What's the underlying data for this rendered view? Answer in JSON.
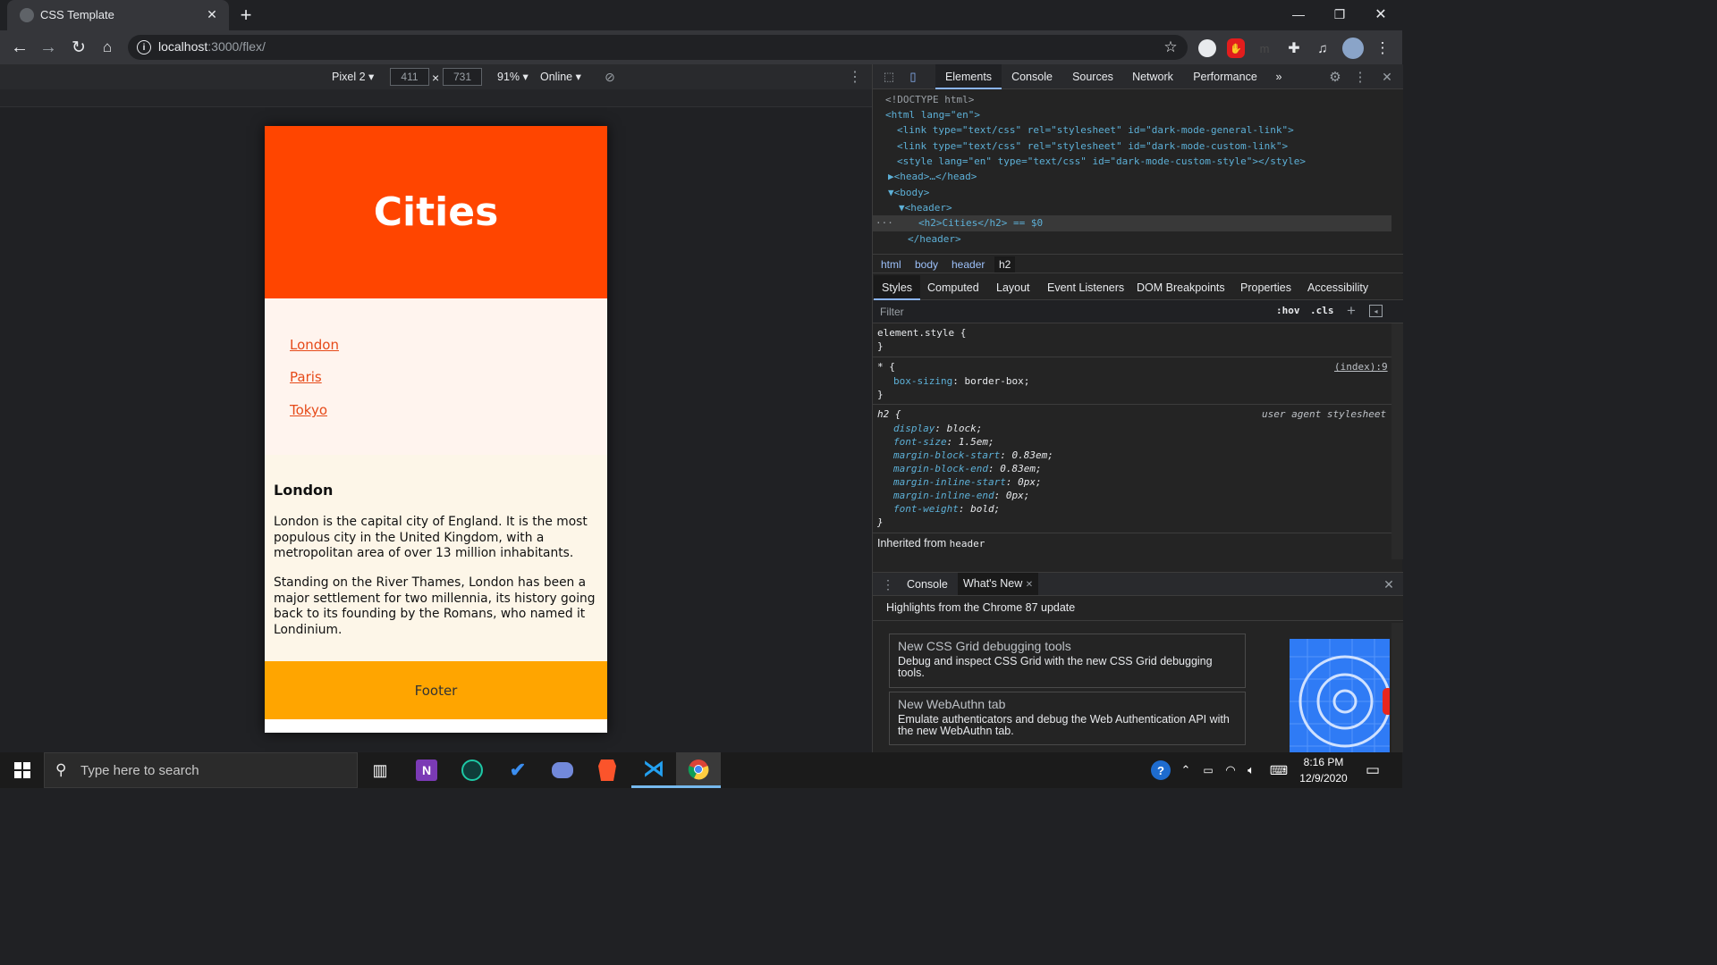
{
  "browser": {
    "tab_title": "CSS Template",
    "url_host": "localhost",
    "url_path": ":3000/flex/"
  },
  "device_toolbar": {
    "device": "Pixel 2",
    "width": "411",
    "times": "×",
    "height": "731",
    "zoom": "91%",
    "network": "Online"
  },
  "emulated_page": {
    "header_title": "Cities",
    "nav_links": [
      "London",
      "Paris",
      "Tokyo"
    ],
    "article_title": "London",
    "article_paragraphs": [
      "London is the capital city of England. It is the most populous city in the United Kingdom, with a metropolitan area of over 13 million inhabitants.",
      "Standing on the River Thames, London has been a major settlement for two millennia, its history going back to its founding by the Romans, who named it Londinium."
    ],
    "footer": "Footer"
  },
  "devtools": {
    "tabs": [
      "Elements",
      "Console",
      "Sources",
      "Network",
      "Performance"
    ],
    "more_tabs": "»",
    "dom_lines": [
      "<!DOCTYPE html>",
      "<html lang=\"en\">",
      "<link type=\"text/css\" rel=\"stylesheet\" id=\"dark-mode-general-link\">",
      "<link type=\"text/css\" rel=\"stylesheet\" id=\"dark-mode-custom-link\">",
      "<style lang=\"en\" type=\"text/css\" id=\"dark-mode-custom-style\"></style>",
      "▶<head>…</head>",
      "▼<body>",
      "▼<header>",
      "<h2>Cities</h2> == $0",
      "</header>"
    ],
    "breadcrumbs": [
      "html",
      "body",
      "header",
      "h2"
    ],
    "style_tabs": [
      "Styles",
      "Computed",
      "Layout",
      "Event Listeners",
      "DOM Breakpoints",
      "Properties",
      "Accessibility"
    ],
    "filter_placeholder": "Filter",
    "hov": ":hov",
    "cls": ".cls",
    "rules": {
      "element_style": "element.style {",
      "close": "}",
      "star_selector": "* {",
      "star_source": "(index):9",
      "star_prop": "box-sizing",
      "star_val": "border-box;",
      "h2_selector": "h2 {",
      "h2_source": "user agent stylesheet",
      "h2_props": [
        {
          "name": "display",
          "value": "block;"
        },
        {
          "name": "font-size",
          "value": "1.5em;"
        },
        {
          "name": "margin-block-start",
          "value": "0.83em;"
        },
        {
          "name": "margin-block-end",
          "value": "0.83em;"
        },
        {
          "name": "margin-inline-start",
          "value": "0px;"
        },
        {
          "name": "margin-inline-end",
          "value": "0px;"
        },
        {
          "name": "font-weight",
          "value": "bold;"
        }
      ],
      "inherited_label": "Inherited from",
      "inherited_from": "header"
    },
    "drawer_tabs": [
      "Console",
      "What's New"
    ],
    "whats_new_heading": "Highlights from the Chrome 87 update",
    "cards": [
      {
        "title": "New CSS Grid debugging tools",
        "desc": "Debug and inspect CSS Grid with the new CSS Grid debugging tools."
      },
      {
        "title": "New WebAuthn tab",
        "desc": "Emulate authenticators and debug the Web Authentication API with the new WebAuthn tab."
      }
    ]
  },
  "taskbar": {
    "search_placeholder": "Type here to search",
    "time": "8:16 PM",
    "date": "12/9/2020"
  }
}
